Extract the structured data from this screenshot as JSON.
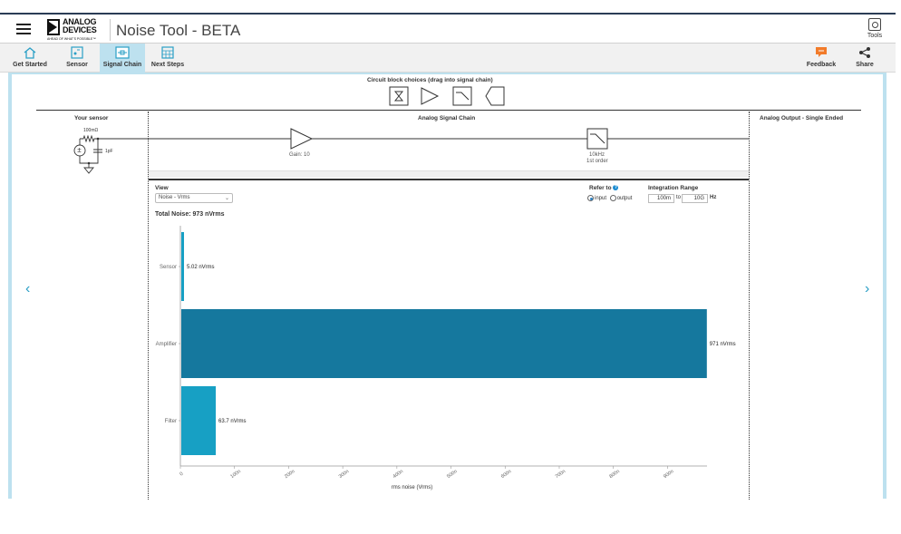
{
  "header": {
    "logo_line1": "ANALOG",
    "logo_line2": "DEVICES",
    "logo_tagline": "AHEAD OF WHAT'S POSSIBLE™",
    "title": "Noise Tool - BETA",
    "tools_label": "Tools"
  },
  "nav": {
    "items": [
      {
        "label": "Get Started",
        "icon": "home-icon"
      },
      {
        "label": "Sensor",
        "icon": "sensor-icon"
      },
      {
        "label": "Signal Chain",
        "icon": "signal-chain-icon",
        "active": true
      },
      {
        "label": "Next Steps",
        "icon": "calendar-icon"
      }
    ],
    "feedback_label": "Feedback",
    "share_label": "Share"
  },
  "blocks": {
    "title": "Circuit block choices (drag into signal chain)",
    "items": [
      "adc-icon",
      "amplifier-icon",
      "filter-icon",
      "output-icon"
    ]
  },
  "sensor": {
    "title": "Your sensor",
    "resistor_label": "100mΩ",
    "cap_label": "1pF"
  },
  "chain": {
    "title": "Analog Signal Chain",
    "amp_label": "Gain: 10",
    "filter_label1": "10kHz",
    "filter_label2": "1st order"
  },
  "output": {
    "title": "Analog Output - Single Ended"
  },
  "controls": {
    "view_label": "View",
    "view_value": "Noise - Vrms",
    "total_noise": "Total Noise: 973 nVrms",
    "refer_label": "Refer to",
    "refer_input": "input",
    "refer_output": "output",
    "integration_label": "Integration Range",
    "range_from": "100m",
    "range_to_word": "to",
    "range_to": "10G",
    "range_unit": "Hz"
  },
  "chart_data": {
    "type": "bar",
    "orientation": "horizontal",
    "categories": [
      "Sensor",
      "Amplifier",
      "Filter"
    ],
    "values": [
      5.02,
      971,
      63.7
    ],
    "value_labels": [
      "5.02 nVrms",
      "971 nVrms",
      "63.7 nVrms"
    ],
    "colors": [
      "#17a0c4",
      "#15789e",
      "#17a0c4"
    ],
    "xlabel": "rms noise (Vrms)",
    "xticks": [
      "0",
      "100n",
      "200n",
      "300n",
      "400n",
      "500n",
      "600n",
      "700n",
      "800n",
      "900n"
    ],
    "xlim": [
      0,
      973
    ]
  }
}
